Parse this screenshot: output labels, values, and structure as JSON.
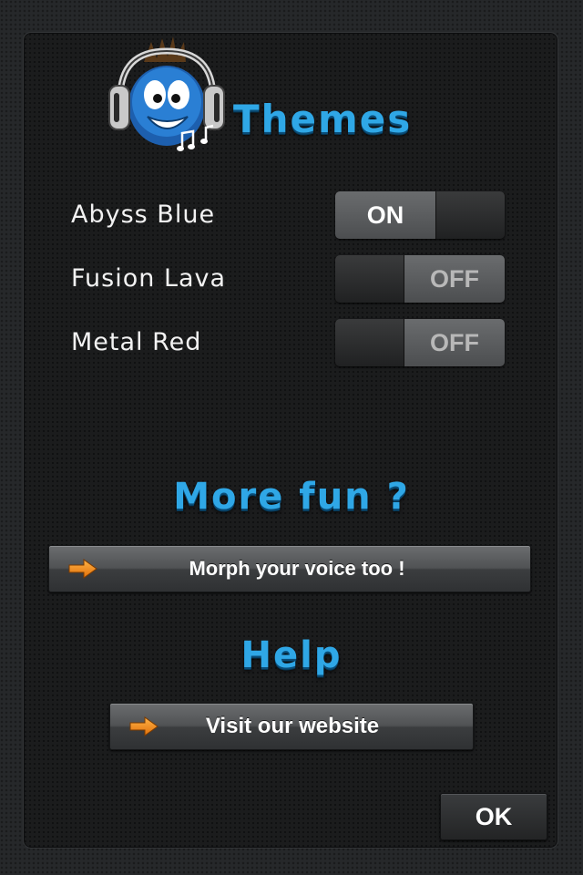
{
  "header": {
    "title": "Themes"
  },
  "themes": [
    {
      "label": "Abyss Blue",
      "state": "ON"
    },
    {
      "label": "Fusion Lava",
      "state": "OFF"
    },
    {
      "label": "Metal Red",
      "state": "OFF"
    }
  ],
  "more_fun": {
    "title": "More fun ?",
    "button_label": "Morph your voice too !"
  },
  "help": {
    "title": "Help",
    "button_label": "Visit our website"
  },
  "ok_label": "OK",
  "colors": {
    "title_blue": "#2fa7e6",
    "arrow_orange": "#f08a10",
    "mascot_blue": "#2a7fd4"
  },
  "icons": {
    "mascot": "headphone-mascot-icon",
    "music_notes": "music-notes-icon",
    "arrow": "arrow-right-icon"
  }
}
